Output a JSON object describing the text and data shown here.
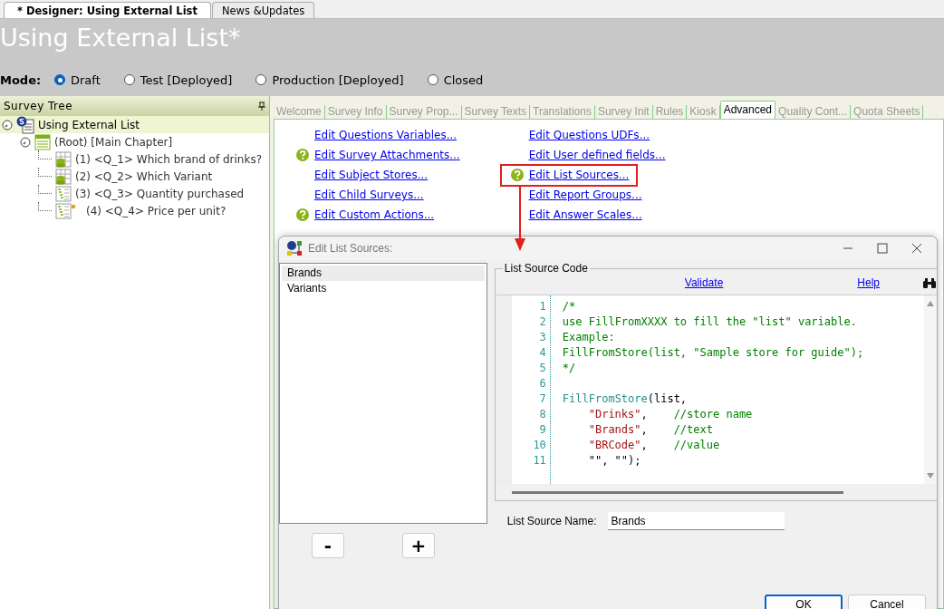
{
  "doc_tabs": [
    {
      "label": "* Designer: Using External List",
      "selected": true
    },
    {
      "label": "News &Updates",
      "selected": false
    }
  ],
  "title": "Using External List*",
  "mode": {
    "label": "Mode:",
    "options": [
      {
        "label": "Draft",
        "selected": true
      },
      {
        "label": "Test [Deployed]",
        "selected": false
      },
      {
        "label": "Production [Deployed]",
        "selected": false
      },
      {
        "label": "Closed",
        "selected": false
      }
    ]
  },
  "survey_tree": {
    "title": "Survey Tree",
    "items": [
      {
        "label": "Using External List",
        "kind": "survey",
        "selected": true,
        "expanded": true,
        "children": [
          {
            "label": "(Root) [Main Chapter]",
            "kind": "chapter",
            "selected": false,
            "expanded": true,
            "children": [
              {
                "label": "(1) <Q_1> Which brand of drinks?",
                "kind": "grid",
                "selected": false,
                "modified": false
              },
              {
                "label": "(2) <Q_2> Which Variant",
                "kind": "grid",
                "selected": false,
                "modified": false
              },
              {
                "label": "(3) <Q_3> Quantity purchased",
                "kind": "numeric",
                "selected": false,
                "modified": false
              },
              {
                "label": "(4) <Q_4> Price per unit?",
                "kind": "numeric",
                "selected": false,
                "modified": true
              }
            ]
          }
        ]
      }
    ]
  },
  "section_tabs": [
    {
      "label": "Welcome",
      "selected": false
    },
    {
      "label": "Survey Info",
      "selected": false
    },
    {
      "label": "Survey  Prop...",
      "selected": false
    },
    {
      "label": "Survey Texts",
      "selected": false
    },
    {
      "label": "Translations",
      "selected": false
    },
    {
      "label": "Survey Init",
      "selected": false
    },
    {
      "label": "Rules",
      "selected": false
    },
    {
      "label": "Kiosk",
      "selected": false
    },
    {
      "label": "Advanced",
      "selected": true
    },
    {
      "label": "Quality  Cont...",
      "selected": false
    },
    {
      "label": "Quota Sheets",
      "selected": false
    }
  ],
  "advanced_links": [
    [
      {
        "label": "Edit Questions Variables...",
        "help": false,
        "highlighted": false
      },
      {
        "label": "Edit Survey Attachments...",
        "help": true,
        "highlighted": false
      },
      {
        "label": "Edit Subject Stores...",
        "help": false,
        "highlighted": false
      },
      {
        "label": "Edit Child Surveys...",
        "help": false,
        "highlighted": false
      },
      {
        "label": "Edit Custom Actions...",
        "help": true,
        "highlighted": false
      }
    ],
    [
      {
        "label": "Edit Questions UDFs...",
        "help": false,
        "highlighted": false
      },
      {
        "label": "Edit User defined fields...",
        "help": false,
        "highlighted": false
      },
      {
        "label": "Edit List Sources...",
        "help": true,
        "highlighted": true
      },
      {
        "label": "Edit Report Groups...",
        "help": false,
        "highlighted": false
      },
      {
        "label": "Edit Answer Scales...",
        "help": false,
        "highlighted": false
      }
    ]
  ],
  "dialog": {
    "title": "Edit List Sources:",
    "list": [
      {
        "label": "Brands",
        "selected": true
      },
      {
        "label": "Variants",
        "selected": false
      }
    ],
    "remove_button": "-",
    "add_button": "+",
    "code_group": "List Source Code",
    "validate_link": "Validate",
    "help_link": "Help",
    "code_lines": [
      {
        "number": "1",
        "indent": false,
        "tokens": [
          {
            "kind": "comment",
            "text": "/*"
          }
        ]
      },
      {
        "number": "2",
        "indent": false,
        "tokens": [
          {
            "kind": "comment",
            "text": "use FillFromXXXX to fill the \"list\" variable."
          }
        ]
      },
      {
        "number": "3",
        "indent": false,
        "tokens": [
          {
            "kind": "comment",
            "text": "Example:"
          }
        ]
      },
      {
        "number": "4",
        "indent": false,
        "tokens": [
          {
            "kind": "comment",
            "text": "FillFromStore(list, \"Sample store for guide\");"
          }
        ]
      },
      {
        "number": "5",
        "indent": false,
        "tokens": [
          {
            "kind": "comment",
            "text": "*/"
          }
        ]
      },
      {
        "number": "6"
      },
      {
        "number": "7",
        "indent": false,
        "tokens": [
          {
            "kind": "function",
            "text": "FillFromStore"
          },
          {
            "kind": "plain",
            "text": "(list,"
          }
        ]
      },
      {
        "number": "8",
        "indent": true,
        "tokens": [
          {
            "kind": "string",
            "text": "\"Drinks\""
          },
          {
            "kind": "plain",
            "text": ",    "
          },
          {
            "kind": "comment",
            "text": "//store name"
          }
        ]
      },
      {
        "number": "9",
        "indent": true,
        "tokens": [
          {
            "kind": "string",
            "text": "\"Brands\""
          },
          {
            "kind": "plain",
            "text": ",    "
          },
          {
            "kind": "comment",
            "text": "//text"
          }
        ]
      },
      {
        "number": "10",
        "indent": true,
        "tokens": [
          {
            "kind": "string",
            "text": "\"BRCode\""
          },
          {
            "kind": "plain",
            "text": ",    "
          },
          {
            "kind": "comment",
            "text": "//value"
          }
        ]
      },
      {
        "number": "11",
        "indent": true,
        "tokens": [
          {
            "kind": "plain",
            "text": "\"\", \"\");"
          }
        ]
      }
    ],
    "name_label": "List Source Name:",
    "name_value": "Brands",
    "buttons": [
      {
        "label": "OK",
        "default": true
      },
      {
        "label": "Cancel",
        "default": false
      }
    ]
  }
}
